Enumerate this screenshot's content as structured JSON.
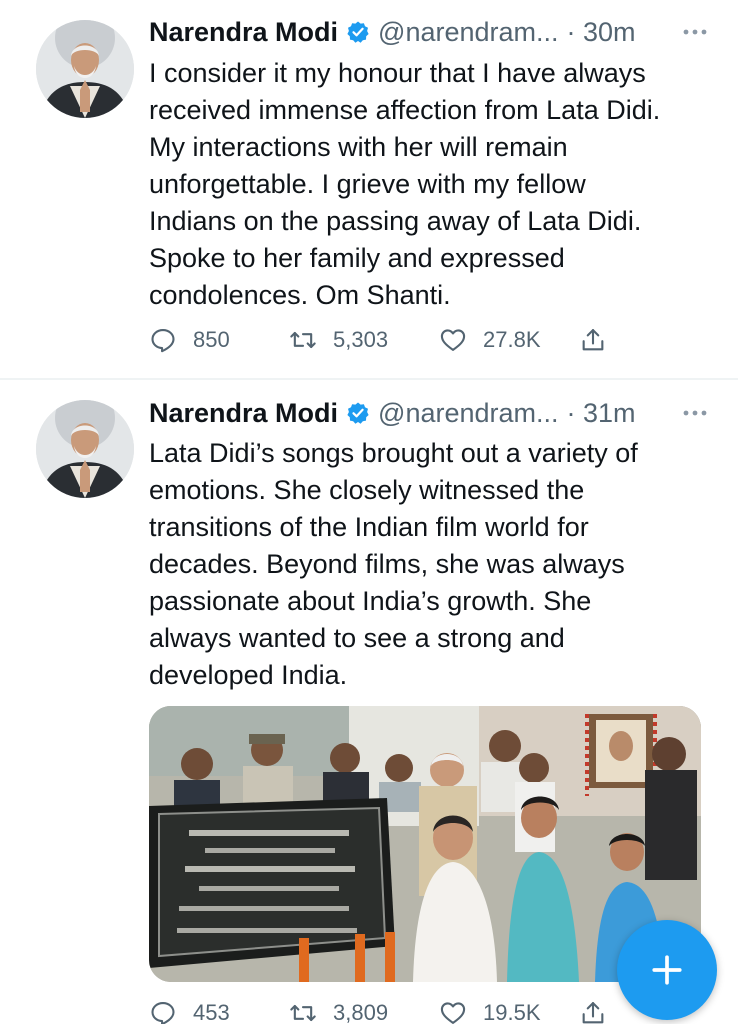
{
  "colors": {
    "accent": "#1d9bf0",
    "text_primary": "#0f1419",
    "text_secondary": "#536471",
    "divider": "#eff3f4"
  },
  "tweets": [
    {
      "author": {
        "name": "Narendra Modi",
        "handle": "@narendram...",
        "verified_icon": "verified-badge-icon",
        "avatar": "profile-photo"
      },
      "time": "· 30m",
      "more_icon": "more-dots-icon",
      "text_lines": [
        "I consider it my honour that I have always",
        "received immense affection from Lata Didi.",
        "My interactions with her will remain",
        "unforgettable. I grieve with my fellow",
        "Indians on the passing away of Lata Didi.",
        "Spoke to her family and expressed",
        "condolences. Om Shanti."
      ],
      "stats": {
        "replies": "850",
        "retweets": "5,303",
        "likes": "27.8K"
      }
    },
    {
      "author": {
        "name": "Narendra Modi",
        "handle": "@narendram...",
        "verified_icon": "verified-badge-icon",
        "avatar": "profile-photo"
      },
      "time": "· 31m",
      "more_icon": "more-dots-icon",
      "text_lines": [
        "Lata Didi’s songs brought out a variety of",
        "emotions. She closely witnessed the",
        "transitions of the Indian film world for",
        "decades. Beyond films, she was always",
        "passionate about India’s growth. She",
        "always wanted to see a strong and",
        "developed India."
      ],
      "media": {
        "type": "photo",
        "icon": "tweet-photo"
      },
      "stats": {
        "replies": "453",
        "retweets": "3,809",
        "likes": "19.5K"
      }
    }
  ],
  "compose_button": {
    "icon": "plus-icon"
  }
}
